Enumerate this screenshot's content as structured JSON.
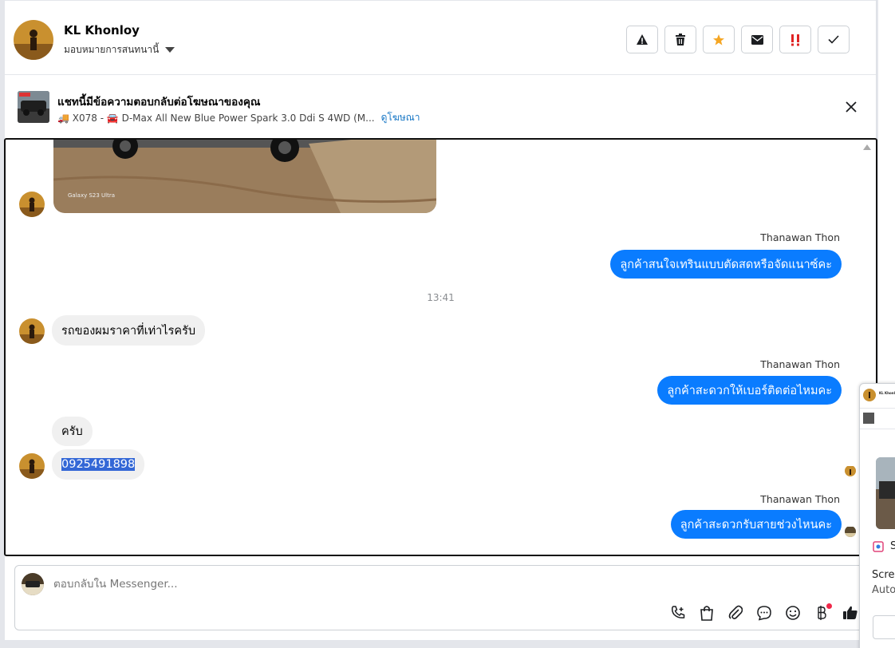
{
  "header": {
    "name": "KL Khonloy",
    "assign_label": "มอบหมายการสนทนานี้",
    "actions": [
      "warning-icon",
      "trash-icon",
      "star-icon",
      "envelope-icon",
      "important-icon",
      "check-icon"
    ]
  },
  "ad": {
    "title": "แชทนี้มีข้อความตอบกลับต่อโฆษณาของคุณ",
    "subtitle": "🚚 X078 - 🚘 D-Max All New Blue Power Spark 3.0 Ddi S 4WD (M...",
    "link": "ดูโฆษณา"
  },
  "thread": {
    "photo_caption": "Galaxy S23 Ultra",
    "messages": [
      {
        "sender": "Thanawan Thon",
        "text": "ลูกค้าสนใจเทรินแบบตัดสดหรือจัดแนาซ์คะ"
      },
      {
        "time": "13:41"
      },
      {
        "text": "รถของผมราคาที่เท่าไรครับ"
      },
      {
        "sender": "Thanawan Thon",
        "text": "ลูกค้าสะดวกให้เบอร์ติดต่อไหมคะ"
      },
      {
        "text": "ครับ"
      },
      {
        "text": "0925491898"
      },
      {
        "sender": "Thanawan Thon",
        "text": "ลูกค้าสะดวกรับสายช่วงไหนคะ"
      }
    ]
  },
  "composer": {
    "placeholder": "ตอบกลับใน Messenger..."
  },
  "side_panel": {
    "name_snippet": "KL Khonl",
    "text1": "S",
    "text2": "Scree",
    "text3": "Auto"
  },
  "colors": {
    "outgoing": "#0a7cff",
    "incoming": "#f0f0f0",
    "selection": "#3367d6",
    "star": "#f5a623",
    "important": "#e02424"
  }
}
